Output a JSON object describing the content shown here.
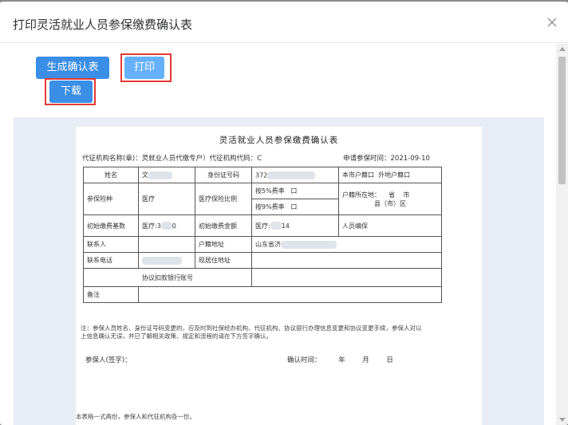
{
  "dialog": {
    "title": "打印灵活就业人员参保缴费确认表",
    "close_icon": "close-icon"
  },
  "toolbar": {
    "generate_label": "生成确认表",
    "print_label": "打印",
    "download_label": "下载"
  },
  "form": {
    "title": "灵活就业人员参保缴费确认表",
    "agency_line": "代征机构名称(章)：灵就业人员代缴专户）代征机构代码：C",
    "apply_time": "申请参保时间：2021-09-10",
    "labels": {
      "name": "姓名",
      "name_value": "文",
      "id_label": "身份证号码",
      "id_value": "372",
      "local_huji": "本市户籍口",
      "other_huji": "外地户籍口",
      "insurance_type": "参保险种",
      "medical": "医疗",
      "ratio": "医疗保险比例",
      "rate5": "按5%费率",
      "rate9": "按9%费率",
      "box": "口",
      "huji_loc": "户籍所在地：",
      "province": "省",
      "city": "市",
      "county": "县（市）区",
      "base": "初始缴费基数",
      "base_value": "医疗:3",
      "base_value_tail": "0",
      "amount": "初始缴费金额",
      "amount_value": "医疗:",
      "amount_value_tail": "14",
      "person_sign": "人员编保",
      "contact": "联系人",
      "huji_address": "户籍地址",
      "huji_address_value": "山东省济",
      "phone": "联系电话",
      "current_address": "现居住地址",
      "bank_account": "协议扣款银行账号",
      "remark": "备注"
    },
    "note": "注：参保人员姓名、身份证号码变更的，应及时到社保经办机构、代征机构、协议银行办理信息变更和协议变更手续，参保人对以上信息确认无误，并已了解相关政策、规定和流程的请在下方签字确认。",
    "signer": "参保人(签字)：",
    "confirm_time": "确认时间：",
    "year": "年",
    "month": "月",
    "day": "日",
    "footer": "本表格一式两份，参保人和代征机构各一份。"
  }
}
